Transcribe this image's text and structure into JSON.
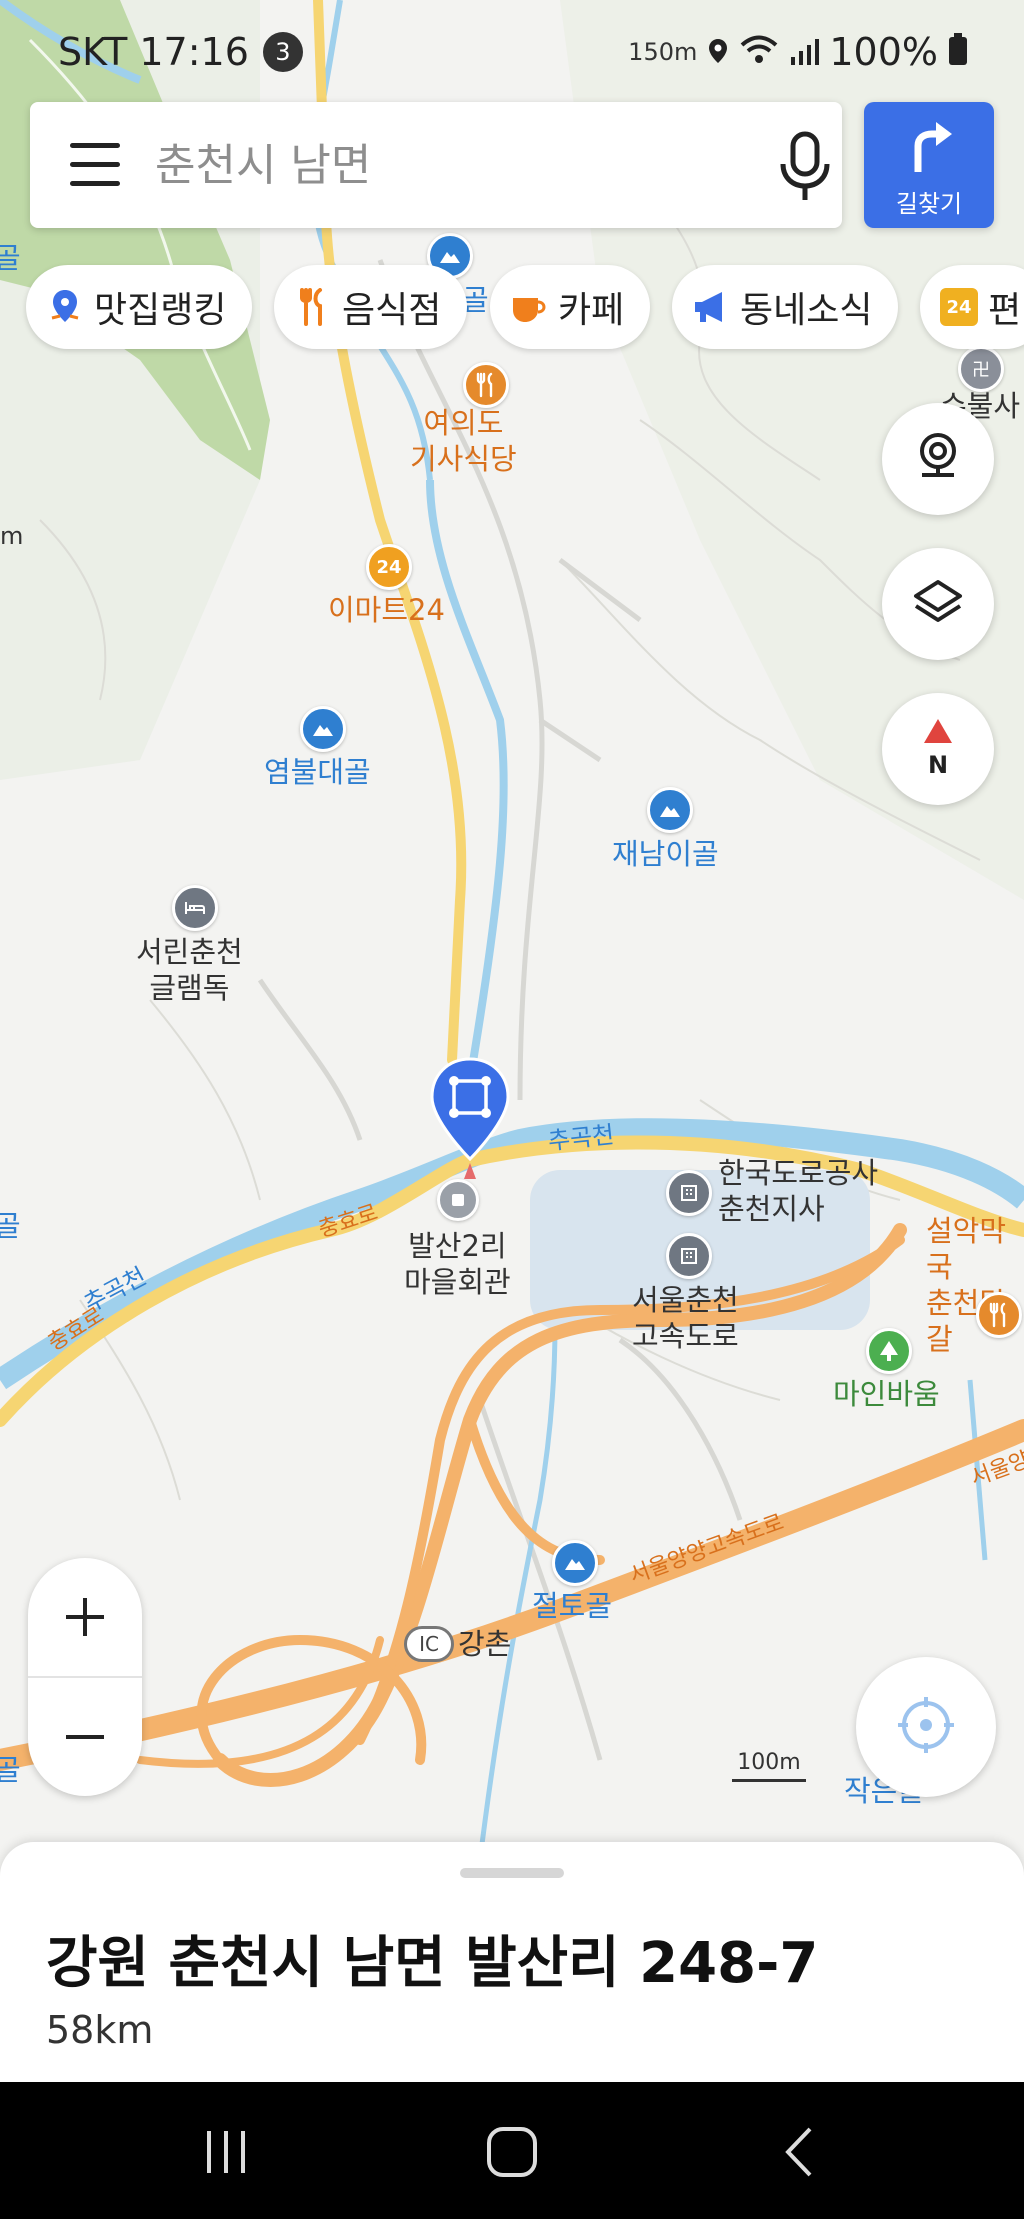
{
  "status_bar": {
    "carrier_time": "SKT 17:16",
    "notification_count": "3",
    "speed": "150m",
    "battery": "100%"
  },
  "search": {
    "placeholder": "춘천시 남면",
    "route_button_label": "길찾기"
  },
  "chips": [
    {
      "label": "맛집랭킹",
      "icon": "map-pin-icon",
      "color": "#3b6fe6"
    },
    {
      "label": "음식점",
      "icon": "utensils-icon",
      "color": "#f07f1c"
    },
    {
      "label": "카페",
      "icon": "coffee-cup-icon",
      "color": "#f07f1c"
    },
    {
      "label": "동네소식",
      "icon": "megaphone-icon",
      "color": "#3b6fe6"
    },
    {
      "label": "편",
      "icon": "convenience-24-icon",
      "color": "#f0b020"
    }
  ],
  "map_labels": {
    "restaurant_yeouido": "여의도\n기사식당",
    "emart24": "이마트24",
    "yeombul_valley": "염불대골",
    "jaenami_valley": "재남이골",
    "glamping": "서린춘천\n글램독",
    "balsan_hall": "발산2리\n마을회관",
    "expressway_corp": "한국도로공사\n춘천지사",
    "seoul_chuncheon_expressway": "서울춘천\n고속도로",
    "mainbawoom": "마인바움",
    "seorak_restaurant": "설악막국\n춘천닭갈",
    "jeolto_valley": "절토골",
    "ic_badge": "IC",
    "gangchon": "강촌",
    "small_valley": "작은골",
    "chugok_stream_1": "추곡천",
    "chugok_stream_2": "추곡천",
    "chunghyo_road_1": "충효로",
    "chunghyo_road_2": "충효로",
    "expressway_name": "서울양양고속도로",
    "expressway_right": "서울양",
    "top_valley_partial": "골",
    "temple_partial": "수불사",
    "left_partial_1": "골",
    "left_partial_2": "골",
    "left_partial_3": "m",
    "left_partial_4": "골"
  },
  "scale_label": "100m",
  "colors": {
    "accent": "#3b6fe6",
    "poi_orange": "#d8701c",
    "water": "#9fd0ec",
    "expressway": "#f4b26b",
    "main_road": "#f6d572",
    "park": "#bfd9a7"
  },
  "bottom_sheet": {
    "address": "강원 춘천시 남면 발산리 248-7",
    "distance": "58km"
  }
}
